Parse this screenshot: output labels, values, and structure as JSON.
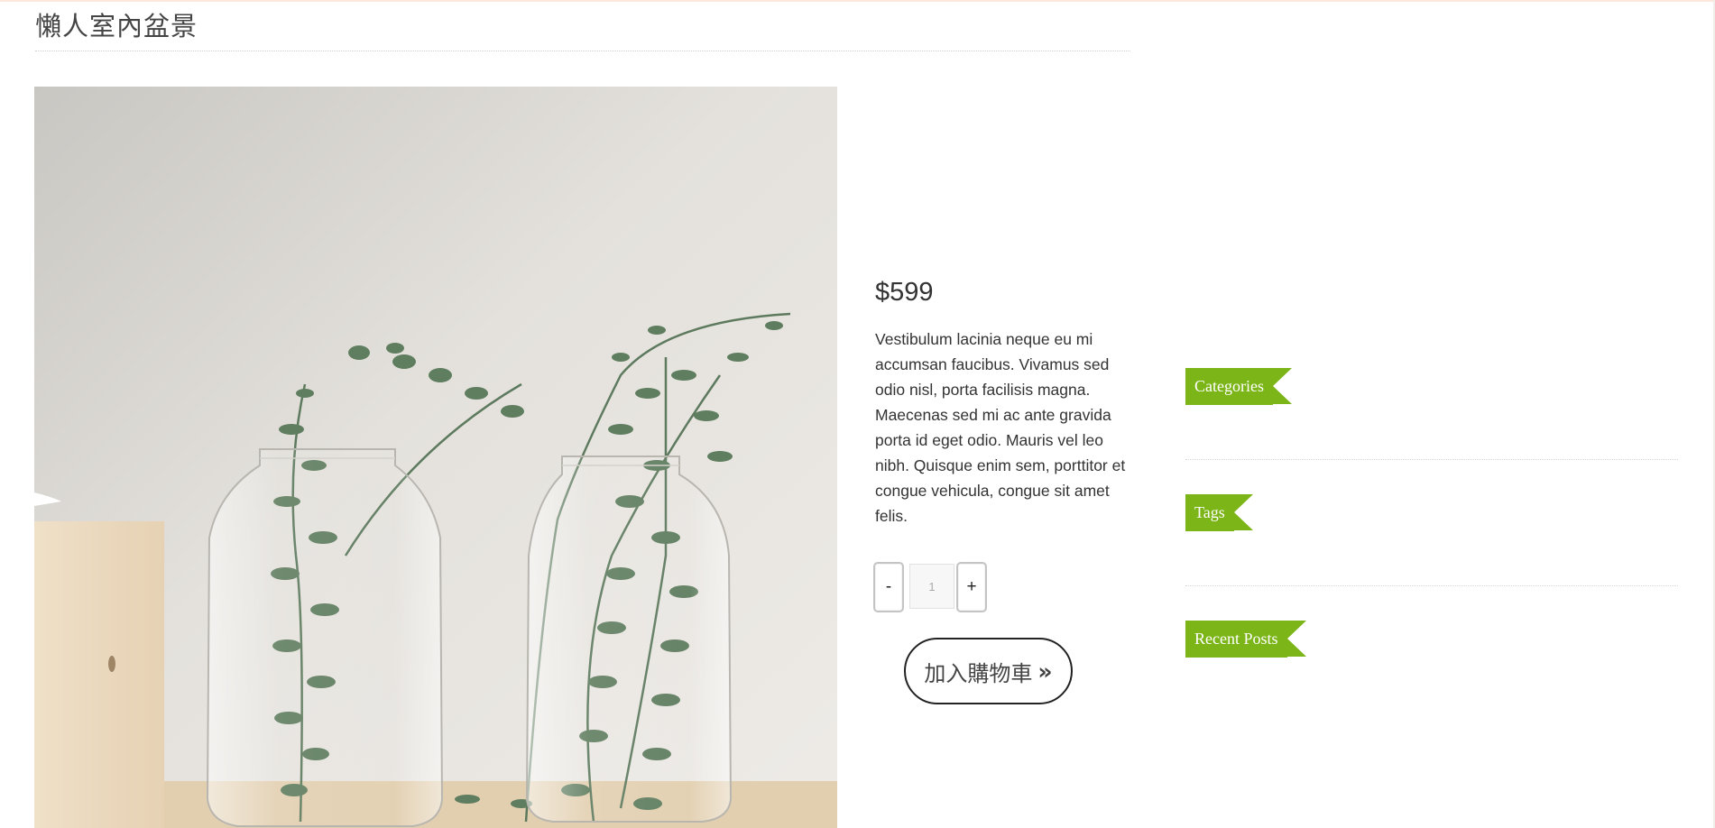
{
  "product": {
    "title": "懶人室內盆景",
    "price": "$599",
    "description": "Vestibulum lacinia neque eu mi accumsan faucibus. Vivamus sed odio nisl, porta facilisis magna. Maecenas sed mi ac ante gravida porta id eget odio. Mauris vel leo nibh. Quisque enim sem, porttitor et congue vehicula, congue sit amet felis."
  },
  "quantity": {
    "minus_label": "-",
    "plus_label": "+",
    "value": "1"
  },
  "cart": {
    "add_label": "加入購物車",
    "arrow": "»"
  },
  "sidebar": {
    "widgets": [
      {
        "title": "Categories"
      },
      {
        "title": "Tags"
      },
      {
        "title": "Recent Posts"
      }
    ]
  },
  "colors": {
    "accent": "#7cb518",
    "text": "#333333"
  }
}
